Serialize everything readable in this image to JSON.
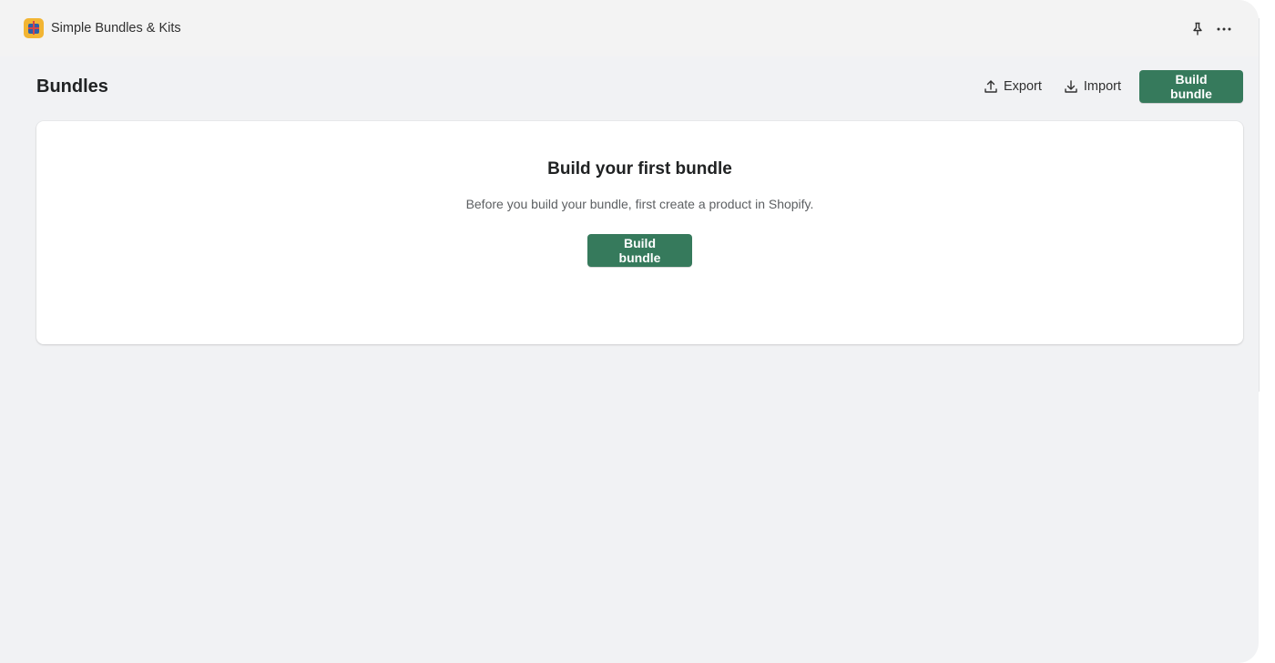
{
  "app_bar": {
    "app_name": "Simple Bundles & Kits",
    "logo_icon": "gift-box-icon",
    "pin_icon": "pin-icon",
    "more_icon": "more-horizontal-icon"
  },
  "page": {
    "title": "Bundles",
    "actions": {
      "export_label": "Export",
      "import_label": "Import",
      "build_label": "Build bundle"
    }
  },
  "empty_state": {
    "heading": "Build your first bundle",
    "description": "Before you build your bundle, first create a product in Shopify.",
    "button_label": "Build bundle"
  },
  "colors": {
    "primary": "#367a5c",
    "background": "#f1f2f4",
    "card": "#ffffff"
  }
}
